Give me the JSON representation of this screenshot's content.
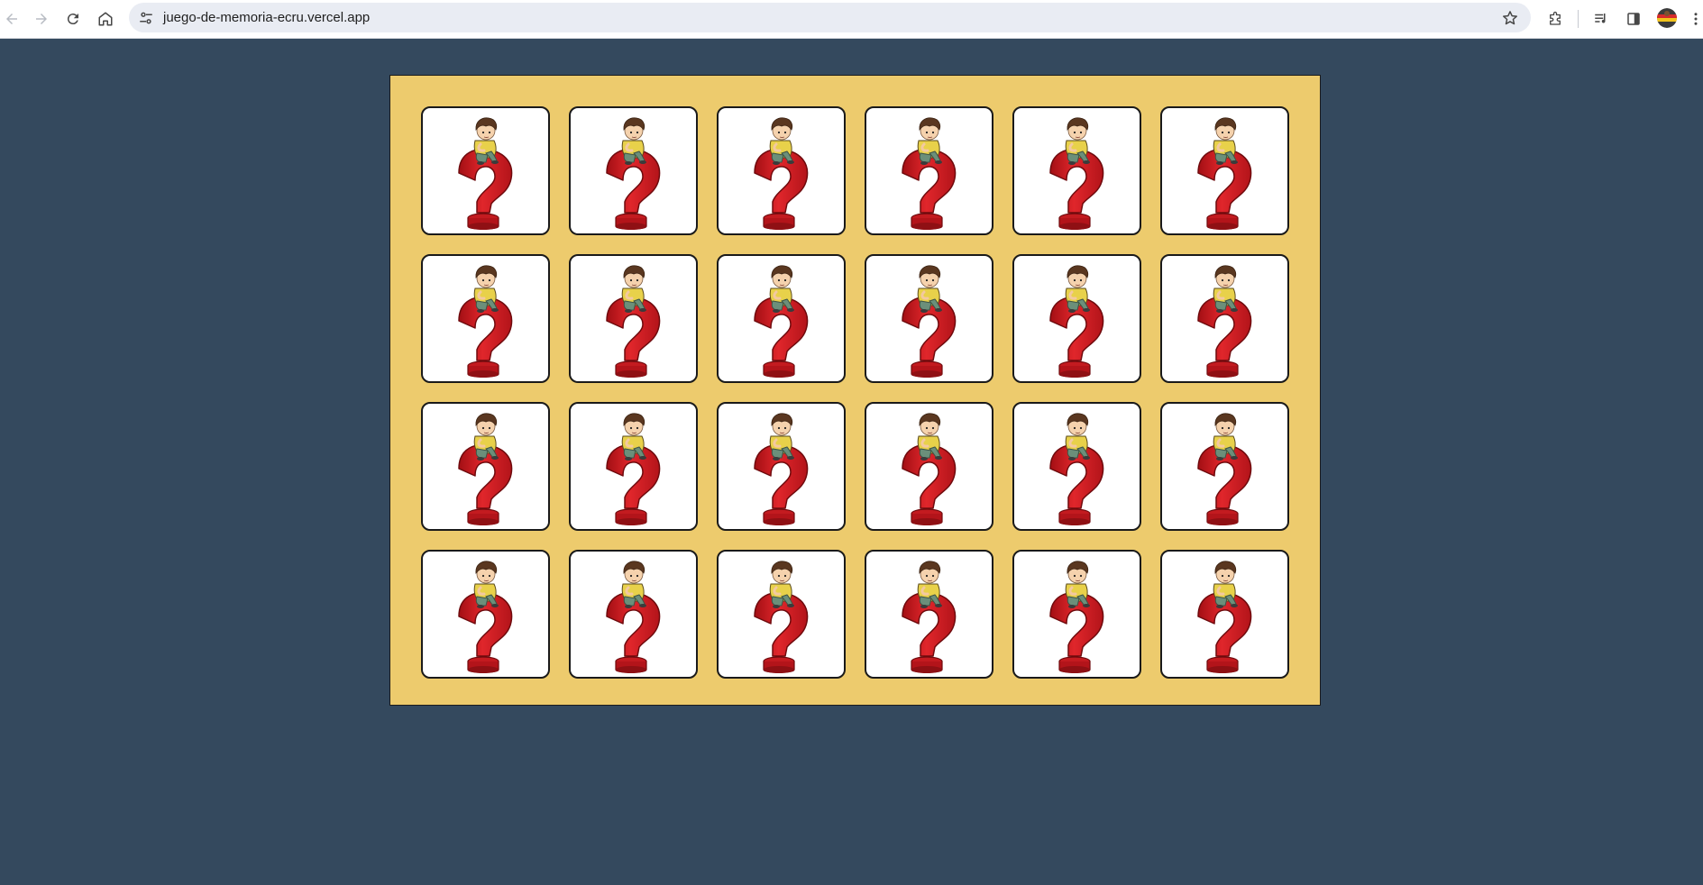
{
  "browser": {
    "url": "juego-de-memoria-ecru.vercel.app",
    "icons": {
      "back": "arrow-left-icon",
      "forward": "arrow-right-icon",
      "reload": "reload-icon",
      "home": "home-icon",
      "site_info": "tune-icon",
      "bookmark": "star-icon",
      "extensions": "puzzle-icon",
      "media": "playlist-icon",
      "side_panel": "side-panel-icon",
      "profile": "avatar"
    }
  },
  "game": {
    "board_color": "#edcb6d",
    "background_color": "#34495e",
    "rows": 4,
    "columns": 6,
    "card_back": "question-mark-boy-card-back",
    "cards_face_down": 24
  }
}
